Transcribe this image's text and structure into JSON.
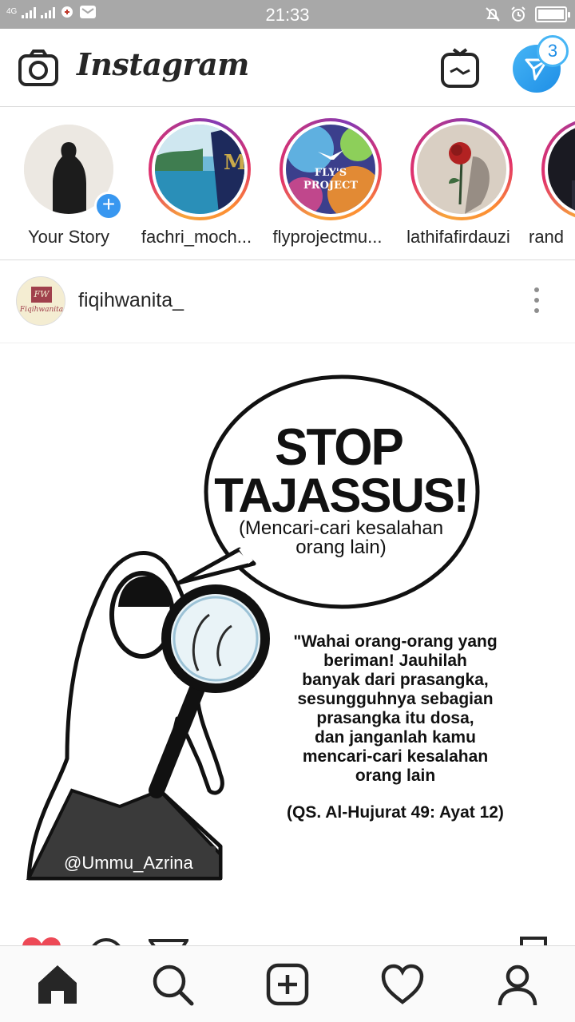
{
  "status_bar": {
    "network": "4G",
    "time": "21:33"
  },
  "header": {
    "logo": "Instagram",
    "dm_badge": "3"
  },
  "stories": [
    {
      "name": "Your Story",
      "own": true
    },
    {
      "name": "fachri_moch..."
    },
    {
      "name": "flyprojectmu..."
    },
    {
      "name": "lathifafirdauzi"
    },
    {
      "name": "rand"
    }
  ],
  "post": {
    "username": "fiqihwanita_",
    "avatar_mark": "FW",
    "avatar_name": "Fiqihwanita",
    "image": {
      "title_line1": "STOP",
      "title_line2": "TAJASSUS!",
      "subtitle_line1": "(Mencari-cari kesalahan",
      "subtitle_line2": "orang lain)",
      "quote_lines": [
        "\"Wahai orang-orang yang",
        "beriman! Jauhilah",
        "banyak dari prasangka,",
        "sesungguhnya sebagian",
        "prasangka itu dosa,",
        "dan janganlah kamu",
        "mencari-cari kesalahan",
        "orang lain"
      ],
      "reference": "(QS. Al-Hujurat 49: Ayat 12)",
      "credit": "@Ummu_Azrina"
    }
  },
  "story_texts": {
    "flyproject_line1": "FLY'S",
    "flyproject_line2": "PROJECT"
  }
}
